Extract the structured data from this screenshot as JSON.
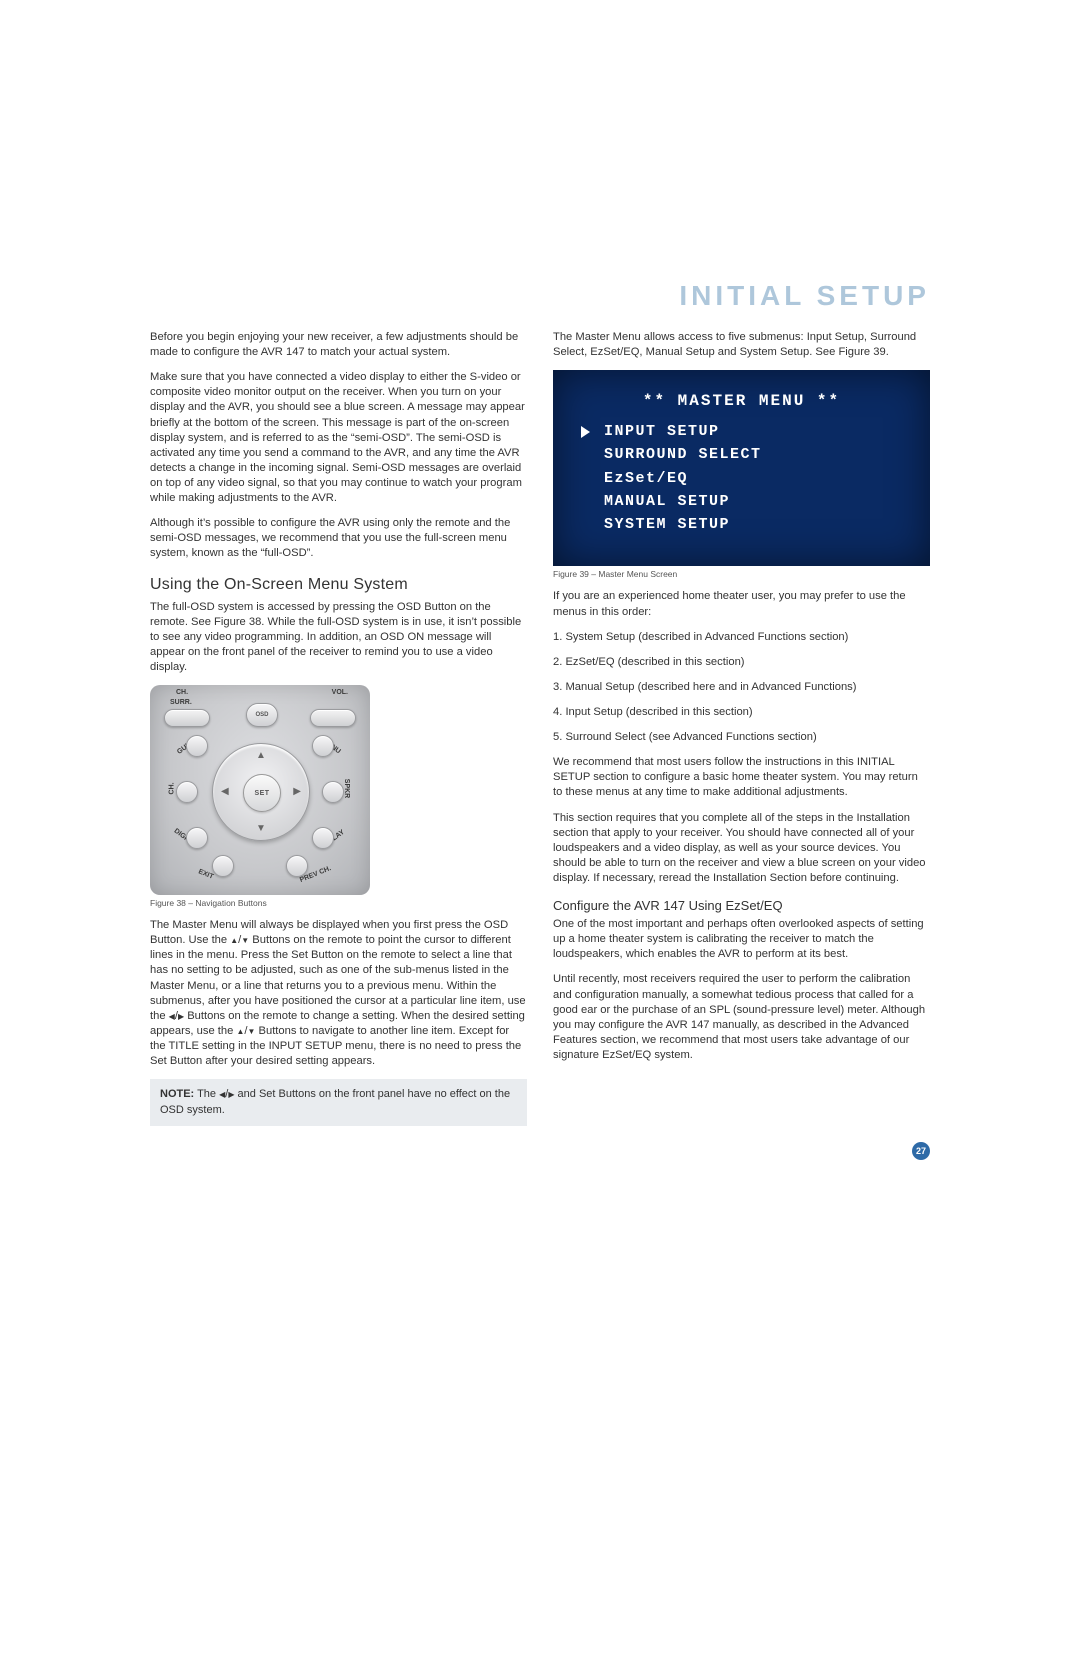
{
  "title": "INITIAL SETUP",
  "page_number": "27",
  "left": {
    "p1": "Before you begin enjoying your new receiver, a few adjustments should be made to configure the AVR 147 to match your actual system.",
    "p2": "Make sure that you have connected a video display to either the S-video or composite video monitor output on the receiver. When you turn on your display and the AVR, you should see a blue screen. A message may appear briefly at the bottom of the screen. This message is part of the on-screen display system, and is referred to as the “semi-OSD”. The semi-OSD is activated any time you send a command to the AVR, and any time the AVR detects a change in the incoming signal. Semi-OSD messages are overlaid on top of any video signal, so that you may continue to watch your program while making adjustments to the AVR.",
    "p3": "Although it’s possible to configure the AVR using only the remote and the semi-OSD messages, we recommend that you use the full-screen menu system, known as the “full-OSD”.",
    "h2": "Using the On-Screen Menu System",
    "p4": "The full-OSD system is accessed by pressing the OSD Button on the remote. See Figure 38. While the full-OSD system is in use, it isn’t possible to see any video programming. In addition, an OSD ON message will appear on the front panel of the receiver to remind you to use a video display.",
    "fig38_caption": "Figure 38 –  Navigation Buttons",
    "p5a": "The Master Menu will always be displayed when you first press the OSD Button. Use the ",
    "p5b": " Buttons on the remote to point the cursor to different lines in the menu. Press the Set Button on the remote to select a line that has no setting to be adjusted, such as one of the sub-menus listed in the Master Menu, or a line that returns you to a previous menu. Within the submenus, after you have positioned the cursor at a particular line item, use the ",
    "p5c": " Buttons on the remote to change a setting. When the desired setting appears, use the ",
    "p5d": " Buttons to navigate to another line item. Except for the TITLE setting in the INPUT SETUP menu, there is no need to press the Set Button after your desired setting appears.",
    "note_bold": "NOTE:",
    "note_a": " The ",
    "note_b": " and Set Buttons on the front panel have no effect on the OSD system.",
    "remote": {
      "ch": "CH.",
      "surr": "SURR.",
      "vol": "VOL.",
      "osd": "OSD",
      "set": "SET",
      "guide": "GUIDE",
      "menu": "MENU",
      "ch2": "CH.",
      "spkr": "SPKR",
      "digital": "DIGITAL",
      "delay": "DELAY",
      "exit": "EXIT",
      "prevch": "PREV CH."
    }
  },
  "right": {
    "p1": "The Master Menu allows access to five submenus: Input Setup, Surround Select, EzSet/EQ, Manual Setup and System Setup. See Figure 39.",
    "screen": {
      "title": "** MASTER MENU **",
      "items": [
        "INPUT SETUP",
        "SURROUND SELECT",
        "EzSet/EQ",
        "MANUAL SETUP",
        "SYSTEM SETUP"
      ]
    },
    "fig39_caption": "Figure 39 – Master Menu Screen",
    "p2": "If you are an experienced home theater user, you may prefer to use the menus in this order:",
    "ol": [
      "1. System Setup (described in Advanced Functions section)",
      "2. EzSet/EQ (described in this section)",
      "3. Manual Setup (described here and in Advanced Functions)",
      "4. Input Setup (described in this section)",
      "5. Surround Select (see Advanced Functions section)"
    ],
    "p3": "We recommend that most users follow the instructions in this INITIAL SETUP section to configure a basic home theater system. You may return to these menus at any time to make additional adjustments.",
    "p4": "This section requires that you complete all of the steps in the Installation section that apply to your receiver. You should have connected all of your loudspeakers and a video display, as well as your source devices. You should be able to turn on the receiver and view a blue screen on your video display. If necessary, reread the Installation Section before continuing.",
    "h3": "Configure the AVR 147 Using EzSet/EQ",
    "p5": "One of the most important and perhaps often overlooked aspects of setting up a home theater system is calibrating the receiver to match the loudspeakers, which enables the AVR to perform at its best.",
    "p6": "Until recently, most receivers required the user to perform the calibration and configuration manually, a somewhat tedious process that called for a good ear or the purchase of an SPL (sound-pressure level) meter. Although you may configure the AVR 147 manually, as described in the Advanced Features section, we recommend that most users take advantage of our signature EzSet/EQ system."
  }
}
